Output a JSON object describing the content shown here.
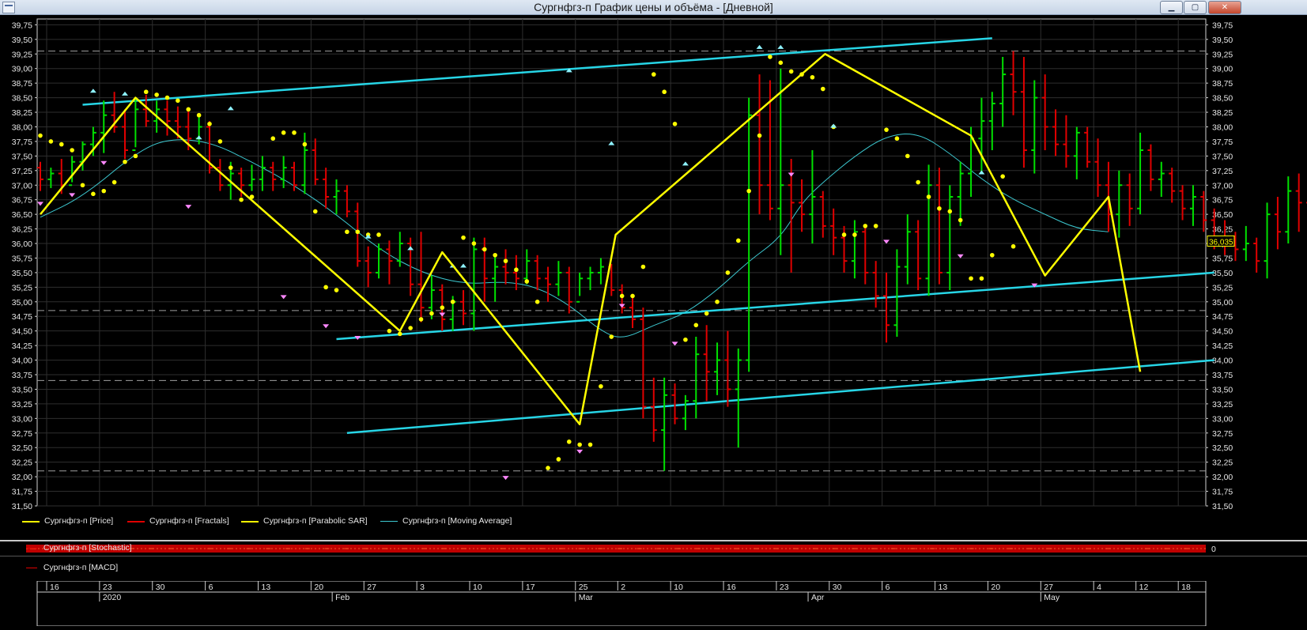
{
  "window": {
    "title": "Сургнфгз-п График цены и объёма - [Дневной]",
    "minimize_glyph": "▁",
    "maximize_glyph": "▢",
    "close_glyph": "✕"
  },
  "colors": {
    "bull_bar": "#00e000",
    "bear_bar": "#e00000",
    "zigzag": "#ffff00",
    "sar": "#ffff00",
    "channel": "#27d5e6",
    "moving_average": "#3cc8d0",
    "fractal_up": "#8ef3ff",
    "fractal_down": "#ff88ff",
    "grid": "#2e2e2e",
    "level_dashed": "#a0a0a0"
  },
  "legend": [
    {
      "label": "Сургнфгз-п [Price]",
      "color": "#ffff00"
    },
    {
      "label": "Сургнфгз-п [Fractals]",
      "color": "#e00000"
    },
    {
      "label": "Сургнфгз-п [Parabolic SAR]",
      "color": "#ffff00"
    },
    {
      "label": "Сургнфгз-п [Moving Average]",
      "color": "#3cc8d0"
    }
  ],
  "stochastic": {
    "label": "Сургнфгз-п [Stochastic]",
    "axis_value": "0"
  },
  "macd": {
    "label": "Сургнфгз-п [MACD]"
  },
  "price_label": "36,035",
  "chart_data": {
    "type": "ohlc",
    "y_ticks": [
      "31,50",
      "31,75",
      "32,00",
      "32,25",
      "32,50",
      "32,75",
      "33,00",
      "33,25",
      "33,50",
      "33,75",
      "34,00",
      "34,25",
      "34,50",
      "34,75",
      "35,00",
      "35,25",
      "35,50",
      "35,75",
      "36,00",
      "36,25",
      "36,50",
      "36,75",
      "37,00",
      "37,25",
      "37,50",
      "37,75",
      "38,00",
      "38,25",
      "38,50",
      "38,75",
      "39,00",
      "39,25",
      "39,50",
      "39,75"
    ],
    "ylim": [
      31.5,
      39.85
    ],
    "x_day_labels": [
      "16",
      "23",
      "30",
      "6",
      "13",
      "20",
      "27",
      "3",
      "10",
      "17",
      "25",
      "2",
      "10",
      "16",
      "23",
      "30",
      "6",
      "13",
      "20",
      "27",
      "4",
      "12",
      "18"
    ],
    "x_month_labels": [
      "2020",
      "Feb",
      "Mar",
      "Apr",
      "May"
    ],
    "ohlc": [
      [
        37.3,
        37.4,
        36.9,
        37.1
      ],
      [
        37.1,
        37.3,
        36.95,
        37.2
      ],
      [
        37.2,
        37.45,
        36.85,
        37.0
      ],
      [
        37.0,
        37.5,
        37.05,
        37.4
      ],
      [
        37.4,
        37.75,
        37.25,
        37.7
      ],
      [
        37.7,
        38.0,
        37.5,
        37.9
      ],
      [
        37.9,
        38.45,
        37.55,
        38.2
      ],
      [
        38.2,
        38.6,
        37.9,
        38.0
      ],
      [
        38.0,
        38.3,
        37.45,
        37.6
      ],
      [
        37.6,
        38.5,
        37.65,
        38.3
      ],
      [
        38.3,
        38.55,
        38.0,
        38.1
      ],
      [
        38.1,
        38.45,
        37.9,
        38.3
      ],
      [
        38.3,
        38.45,
        37.85,
        38.1
      ],
      [
        38.1,
        38.35,
        37.8,
        38.0
      ],
      [
        38.0,
        38.3,
        37.6,
        37.8
      ],
      [
        37.8,
        38.2,
        37.7,
        38.0
      ],
      [
        38.0,
        38.1,
        37.2,
        37.3
      ],
      [
        37.3,
        37.45,
        36.9,
        37.0
      ],
      [
        37.0,
        37.4,
        36.75,
        37.2
      ],
      [
        37.2,
        37.3,
        36.8,
        37.0
      ],
      [
        37.0,
        37.35,
        36.9,
        37.1
      ],
      [
        37.1,
        37.5,
        36.9,
        37.3
      ],
      [
        37.3,
        37.4,
        36.9,
        37.1
      ],
      [
        37.1,
        37.5,
        36.95,
        37.3
      ],
      [
        37.3,
        37.4,
        36.9,
        37.0
      ],
      [
        37.0,
        37.9,
        36.85,
        37.6
      ],
      [
        37.6,
        37.8,
        37.0,
        37.1
      ],
      [
        37.1,
        37.3,
        36.6,
        36.8
      ],
      [
        36.8,
        37.1,
        36.5,
        36.9
      ],
      [
        36.9,
        37.0,
        36.45,
        36.55
      ],
      [
        36.55,
        36.7,
        35.6,
        35.7
      ],
      [
        35.7,
        35.95,
        35.25,
        35.5
      ],
      [
        35.5,
        36.0,
        35.4,
        35.9
      ],
      [
        35.9,
        36.05,
        35.3,
        35.7
      ],
      [
        35.7,
        36.2,
        35.6,
        36.0
      ],
      [
        36.0,
        36.1,
        35.1,
        35.3
      ],
      [
        35.3,
        36.2,
        34.65,
        34.9
      ],
      [
        34.9,
        35.45,
        34.7,
        35.2
      ],
      [
        35.2,
        35.3,
        34.5,
        34.7
      ],
      [
        34.7,
        35.1,
        34.5,
        35.0
      ],
      [
        35.0,
        35.2,
        34.6,
        34.8
      ],
      [
        34.8,
        36.1,
        34.5,
        35.9
      ],
      [
        35.9,
        36.1,
        35.0,
        35.4
      ],
      [
        35.4,
        35.8,
        35.0,
        35.6
      ],
      [
        35.6,
        35.9,
        35.3,
        35.5
      ],
      [
        35.5,
        35.8,
        35.2,
        35.4
      ],
      [
        35.4,
        35.9,
        35.3,
        35.7
      ],
      [
        35.7,
        35.8,
        35.2,
        35.4
      ],
      [
        35.4,
        35.6,
        35.0,
        35.3
      ],
      [
        35.3,
        35.7,
        35.1,
        35.5
      ],
      [
        35.5,
        35.6,
        34.8,
        35.0
      ],
      [
        35.0,
        35.5,
        35.1,
        35.4
      ],
      [
        35.4,
        35.6,
        35.2,
        35.5
      ],
      [
        35.5,
        35.75,
        35.3,
        35.6
      ],
      [
        35.6,
        35.65,
        35.1,
        35.2
      ],
      [
        35.2,
        35.3,
        34.8,
        34.9
      ],
      [
        34.9,
        35.1,
        34.55,
        34.7
      ],
      [
        34.7,
        34.9,
        33.0,
        33.2
      ],
      [
        33.2,
        33.7,
        32.6,
        32.8
      ],
      [
        32.8,
        33.7,
        32.1,
        33.4
      ],
      [
        33.4,
        33.6,
        32.9,
        33.0
      ],
      [
        33.0,
        33.4,
        32.8,
        33.3
      ],
      [
        33.3,
        34.4,
        33.0,
        34.1
      ],
      [
        34.1,
        34.6,
        33.3,
        33.8
      ],
      [
        33.8,
        34.3,
        33.4,
        34.0
      ],
      [
        34.0,
        34.5,
        33.2,
        33.5
      ],
      [
        33.5,
        34.2,
        32.5,
        34.0
      ],
      [
        34.0,
        38.5,
        33.8,
        38.2
      ],
      [
        38.2,
        38.9,
        36.5,
        37.0
      ],
      [
        37.0,
        38.8,
        36.4,
        36.6
      ],
      [
        36.6,
        39.0,
        35.8,
        37.0
      ],
      [
        37.0,
        37.45,
        35.5,
        36.7
      ],
      [
        36.7,
        37.1,
        36.2,
        36.5
      ],
      [
        36.5,
        37.6,
        36.0,
        36.8
      ],
      [
        36.8,
        36.9,
        36.1,
        36.3
      ],
      [
        36.3,
        36.6,
        35.8,
        36.1
      ],
      [
        36.1,
        36.3,
        35.5,
        35.7
      ],
      [
        35.7,
        36.4,
        35.4,
        36.2
      ],
      [
        36.2,
        36.3,
        35.3,
        35.5
      ],
      [
        35.5,
        35.7,
        34.9,
        35.1
      ],
      [
        35.1,
        35.5,
        34.3,
        34.6
      ],
      [
        34.6,
        35.9,
        34.4,
        35.6
      ],
      [
        35.6,
        36.5,
        35.3,
        36.2
      ],
      [
        36.2,
        36.4,
        35.2,
        35.4
      ],
      [
        35.4,
        37.35,
        35.1,
        37.0
      ],
      [
        37.0,
        37.3,
        35.3,
        35.5
      ],
      [
        35.5,
        37.0,
        35.2,
        36.8
      ],
      [
        36.8,
        37.4,
        36.3,
        37.2
      ],
      [
        37.2,
        38.0,
        36.8,
        37.8
      ],
      [
        37.8,
        38.5,
        37.2,
        38.1
      ],
      [
        38.1,
        38.6,
        37.6,
        38.4
      ],
      [
        38.4,
        39.2,
        38.0,
        38.9
      ],
      [
        38.9,
        39.3,
        38.2,
        38.6
      ],
      [
        38.6,
        39.2,
        37.3,
        37.6
      ],
      [
        37.6,
        38.8,
        37.2,
        38.5
      ],
      [
        38.5,
        38.9,
        37.6,
        38.0
      ],
      [
        38.0,
        38.3,
        37.5,
        37.7
      ],
      [
        37.7,
        38.2,
        37.3,
        37.5
      ],
      [
        37.5,
        38.0,
        37.1,
        37.9
      ],
      [
        37.9,
        38.0,
        37.3,
        37.4
      ],
      [
        37.4,
        37.8,
        36.8,
        37.0
      ],
      [
        37.0,
        37.4,
        36.2,
        36.5
      ],
      [
        36.5,
        37.25,
        36.1,
        37.0
      ],
      [
        37.0,
        37.2,
        36.3,
        36.6
      ],
      [
        36.6,
        37.9,
        36.5,
        37.6
      ],
      [
        37.6,
        37.7,
        36.9,
        37.1
      ],
      [
        37.1,
        37.4,
        36.8,
        37.2
      ],
      [
        37.2,
        37.3,
        36.7,
        36.9
      ],
      [
        36.9,
        37.0,
        36.4,
        36.6
      ],
      [
        36.6,
        37.0,
        36.3,
        36.8
      ],
      [
        36.8,
        36.9,
        36.2,
        36.4
      ],
      [
        36.4,
        36.6,
        35.9,
        36.1
      ],
      [
        36.1,
        36.4,
        35.8,
        36.0
      ],
      [
        36.0,
        36.2,
        35.7,
        35.9
      ],
      [
        35.9,
        36.3,
        35.7,
        36.0
      ],
      [
        36.0,
        36.1,
        35.5,
        35.7
      ],
      [
        35.7,
        36.7,
        35.4,
        36.5
      ],
      [
        36.5,
        36.8,
        35.9,
        36.2
      ],
      [
        36.2,
        37.15,
        36.0,
        36.9
      ],
      [
        36.9,
        37.2,
        36.2,
        36.7
      ],
      [
        36.7,
        37.1,
        35.95,
        36.035
      ]
    ],
    "zigzag": [
      [
        0,
        36.5
      ],
      [
        9,
        38.5
      ],
      [
        34,
        34.5
      ],
      [
        38,
        35.85
      ],
      [
        51,
        32.9
      ],
      [
        54.4,
        36.15
      ],
      [
        74.2,
        39.25
      ],
      [
        88,
        37.85
      ],
      [
        95,
        35.45
      ],
      [
        101,
        36.8
      ],
      [
        104,
        33.8
      ]
    ],
    "ma_anchors": [
      [
        0,
        36.45
      ],
      [
        4,
        36.8
      ],
      [
        9,
        37.55
      ],
      [
        12,
        37.8
      ],
      [
        16,
        37.75
      ],
      [
        20,
        37.4
      ],
      [
        24,
        37.0
      ],
      [
        28,
        36.5
      ],
      [
        32,
        35.9
      ],
      [
        36,
        35.5
      ],
      [
        40,
        35.3
      ],
      [
        44,
        35.35
      ],
      [
        47,
        35.25
      ],
      [
        50,
        34.95
      ],
      [
        53,
        34.5
      ],
      [
        55,
        34.35
      ],
      [
        58,
        34.6
      ],
      [
        61,
        34.8
      ],
      [
        64,
        35.2
      ],
      [
        67,
        35.7
      ],
      [
        70,
        36.1
      ],
      [
        72,
        36.7
      ],
      [
        74,
        37.05
      ],
      [
        77,
        37.5
      ],
      [
        80,
        37.85
      ],
      [
        83,
        37.9
      ],
      [
        86,
        37.55
      ],
      [
        89,
        37.1
      ],
      [
        92,
        36.75
      ],
      [
        95,
        36.5
      ],
      [
        98,
        36.25
      ],
      [
        101,
        36.2
      ]
    ],
    "channels": [
      {
        "from": [
          4,
          38.38
        ],
        "to": [
          90,
          39.52
        ]
      },
      {
        "from": [
          28,
          34.36
        ],
        "to": [
          111,
          35.5
        ]
      },
      {
        "from": [
          29,
          32.75
        ],
        "to": [
          111,
          34.0
        ]
      }
    ],
    "dashed_levels": [
      39.3,
      34.85,
      33.65,
      32.1
    ],
    "sar_points": [
      [
        0,
        37.85
      ],
      [
        1,
        37.75
      ],
      [
        2,
        37.7
      ],
      [
        3,
        37.6
      ],
      [
        4,
        37.0
      ],
      [
        5,
        36.85
      ],
      [
        6,
        36.9
      ],
      [
        7,
        37.05
      ],
      [
        8,
        37.4
      ],
      [
        9,
        37.5
      ],
      [
        10,
        38.6
      ],
      [
        11,
        38.55
      ],
      [
        12,
        38.5
      ],
      [
        13,
        38.45
      ],
      [
        14,
        38.3
      ],
      [
        15,
        38.2
      ],
      [
        16,
        38.05
      ],
      [
        17,
        37.75
      ],
      [
        18,
        37.3
      ],
      [
        19,
        36.75
      ],
      [
        20,
        36.8
      ],
      [
        22,
        37.8
      ],
      [
        23,
        37.9
      ],
      [
        24,
        37.9
      ],
      [
        25,
        37.7
      ],
      [
        26,
        36.55
      ],
      [
        27,
        35.25
      ],
      [
        28,
        35.2
      ],
      [
        29,
        36.2
      ],
      [
        30,
        36.2
      ],
      [
        31,
        36.15
      ],
      [
        32,
        36.15
      ],
      [
        33,
        34.5
      ],
      [
        34,
        34.45
      ],
      [
        35,
        34.55
      ],
      [
        36,
        34.7
      ],
      [
        37,
        34.8
      ],
      [
        38,
        34.9
      ],
      [
        39,
        35.0
      ],
      [
        40,
        36.1
      ],
      [
        41,
        36.0
      ],
      [
        42,
        35.9
      ],
      [
        43,
        35.8
      ],
      [
        44,
        35.7
      ],
      [
        45,
        35.55
      ],
      [
        46,
        35.35
      ],
      [
        47,
        35.0
      ],
      [
        48,
        32.15
      ],
      [
        49,
        32.3
      ],
      [
        50,
        32.6
      ],
      [
        51,
        32.55
      ],
      [
        52,
        32.55
      ],
      [
        53,
        33.55
      ],
      [
        54,
        34.4
      ],
      [
        55,
        35.1
      ],
      [
        56,
        35.1
      ],
      [
        57,
        35.6
      ],
      [
        58,
        38.9
      ],
      [
        59,
        38.6
      ],
      [
        60,
        38.05
      ],
      [
        61,
        34.35
      ],
      [
        62,
        34.6
      ],
      [
        63,
        34.8
      ],
      [
        64,
        35.0
      ],
      [
        65,
        35.5
      ],
      [
        66,
        36.05
      ],
      [
        67,
        36.9
      ],
      [
        68,
        37.85
      ],
      [
        69,
        39.2
      ],
      [
        70,
        39.1
      ],
      [
        71,
        38.95
      ],
      [
        72,
        38.9
      ],
      [
        73,
        38.85
      ],
      [
        74,
        38.65
      ],
      [
        75,
        38.0
      ],
      [
        76,
        36.15
      ],
      [
        77,
        36.15
      ],
      [
        78,
        36.3
      ],
      [
        79,
        36.3
      ],
      [
        80,
        37.95
      ],
      [
        81,
        37.8
      ],
      [
        82,
        37.5
      ],
      [
        83,
        37.05
      ],
      [
        84,
        36.8
      ],
      [
        85,
        36.6
      ],
      [
        86,
        36.55
      ],
      [
        87,
        36.4
      ],
      [
        88,
        35.4
      ],
      [
        89,
        35.4
      ],
      [
        90,
        35.8
      ],
      [
        91,
        37.15
      ],
      [
        92,
        35.95
      ]
    ],
    "fractals_up": [
      [
        5,
        38.6
      ],
      [
        8,
        38.55
      ],
      [
        15,
        37.8
      ],
      [
        18,
        38.3
      ],
      [
        31,
        36.1
      ],
      [
        35,
        35.9
      ],
      [
        39,
        35.6
      ],
      [
        40,
        35.6
      ],
      [
        50,
        38.95
      ],
      [
        54,
        37.7
      ],
      [
        61,
        37.35
      ],
      [
        68,
        39.35
      ],
      [
        70,
        39.35
      ],
      [
        75,
        38.0
      ],
      [
        89,
        37.2
      ]
    ],
    "fractals_down": [
      [
        0,
        36.7
      ],
      [
        3,
        36.85
      ],
      [
        6,
        37.4
      ],
      [
        14,
        36.65
      ],
      [
        23,
        35.1
      ],
      [
        27,
        34.6
      ],
      [
        30,
        34.4
      ],
      [
        38,
        34.8
      ],
      [
        44,
        32.0
      ],
      [
        51,
        32.45
      ],
      [
        55,
        34.95
      ],
      [
        60,
        34.3
      ],
      [
        71,
        37.2
      ],
      [
        80,
        36.05
      ],
      [
        87,
        35.8
      ],
      [
        94,
        35.3
      ]
    ],
    "fractals_up_days": [
      7,
      9,
      15,
      19,
      31,
      35,
      39,
      40,
      50,
      54,
      61,
      68,
      70,
      75,
      89
    ],
    "fractals_down_days": [
      0,
      3,
      6,
      14,
      23,
      27,
      30,
      38,
      44,
      51,
      55,
      60,
      71,
      80,
      87,
      94
    ]
  }
}
